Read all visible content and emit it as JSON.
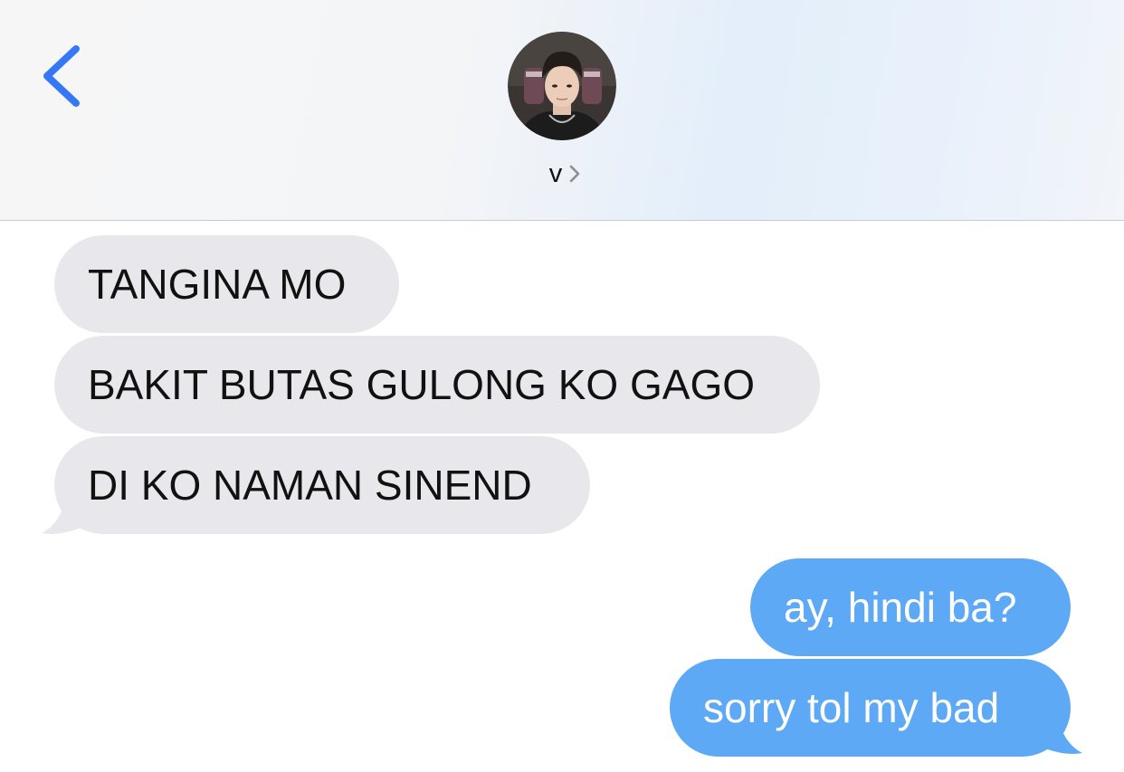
{
  "header": {
    "back_icon": "chevron-left-icon",
    "avatar_icon": "contact-avatar",
    "contact_name": "v",
    "contact_chevron_icon": "chevron-right-icon",
    "accent_color": "#3478f6"
  },
  "messages": {
    "incoming": [
      {
        "text": "TANGINA MO"
      },
      {
        "text": "BAKIT BUTAS GULONG KO GAGO"
      },
      {
        "text": "DI KO NAMAN SINEND"
      }
    ],
    "outgoing": [
      {
        "text": "ay, hindi ba?"
      },
      {
        "text": "sorry tol my bad"
      }
    ]
  },
  "colors": {
    "incoming_bubble": "#e8e8ec",
    "outgoing_bubble": "#5ea9f5",
    "incoming_text": "#111111",
    "outgoing_text": "#ffffff"
  }
}
